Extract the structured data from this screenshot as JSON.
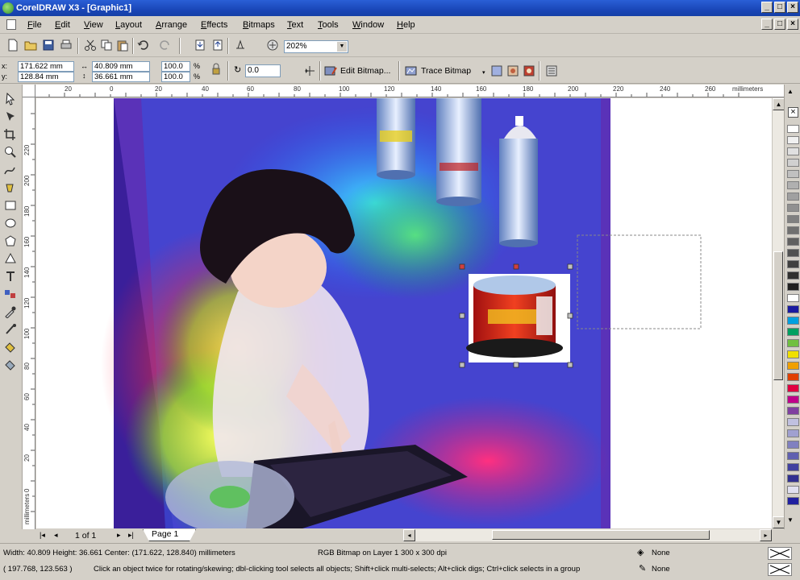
{
  "window": {
    "title": "CorelDRAW X3 - [Graphic1]",
    "buttons": [
      "_",
      "□",
      "×"
    ]
  },
  "menu": [
    "File",
    "Edit",
    "View",
    "Layout",
    "Arrange",
    "Effects",
    "Bitmaps",
    "Text",
    "Tools",
    "Window",
    "Help"
  ],
  "toolbar": {
    "zoom_value": "202%"
  },
  "property_bar": {
    "x_label": "x:",
    "y_label": "y:",
    "x_value": "171.622 mm",
    "y_value": "128.84 mm",
    "width_value": "40.809 mm",
    "height_value": "36.661 mm",
    "scale_x": "100.0",
    "scale_y": "100.0",
    "percent": "%",
    "rotation": "0.0",
    "edit_bitmap": "Edit Bitmap...",
    "trace_bitmap": "Trace Bitmap"
  },
  "ruler": {
    "unit": "millimeters",
    "h_labels": [
      "20",
      "0",
      "20",
      "40",
      "60",
      "80",
      "100",
      "120",
      "140",
      "160",
      "180",
      "200",
      "220",
      "240",
      "260"
    ],
    "v_labels": [
      "220",
      "200",
      "180",
      "160",
      "140",
      "120",
      "100",
      "80",
      "60",
      "40",
      "20",
      "0"
    ]
  },
  "page_nav": {
    "page_count": "1 of 1",
    "page_tab": "Page 1"
  },
  "status": {
    "object_info": "Width: 40.809  Height: 36.661  Center: (171.622, 128.840)  millimeters",
    "object_desc": "RGB Bitmap on Layer 1 300 x 300 dpi",
    "cursor_pos": "( 197.768, 123.563 )",
    "hint": "Click an object twice for rotating/skewing; dbl-clicking tool selects all objects; Shift+click multi-selects; Alt+click digs; Ctrl+click selects in a group",
    "fill": "None",
    "outline": "None"
  },
  "palette_colors": [
    "#ffffff",
    "#f0f0f0",
    "#e0e0e0",
    "#d0d0d0",
    "#c0c0c0",
    "#b0b0b0",
    "#a0a0a0",
    "#909090",
    "#808080",
    "#707070",
    "#606060",
    "#505050",
    "#404040",
    "#303030",
    "#202020",
    "#ffffff",
    "#1a1aa0",
    "#00a0e0",
    "#00a060",
    "#70c040",
    "#f0e000",
    "#f0a000",
    "#e04000",
    "#e00040",
    "#c0008a",
    "#8040a0",
    "#c0c0e0",
    "#a0a0d0",
    "#8080c0",
    "#6060b0",
    "#4040a0",
    "#303090",
    "#e0e0f0",
    "#2020a0"
  ]
}
